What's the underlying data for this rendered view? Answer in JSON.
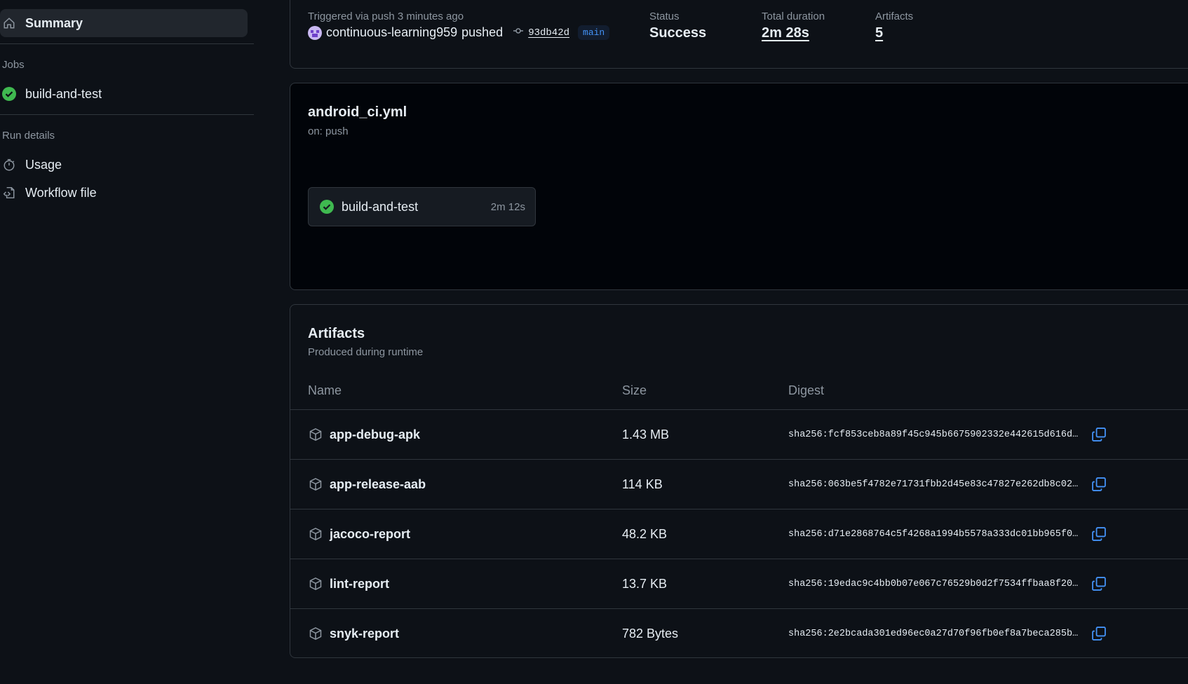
{
  "sidebar": {
    "summary_label": "Summary",
    "jobs_heading": "Jobs",
    "job_label": "build-and-test",
    "run_details_heading": "Run details",
    "usage_label": "Usage",
    "workflow_file_label": "Workflow file"
  },
  "run": {
    "trigger_text": "Triggered via push 3 minutes ago",
    "actor": "continuous-learning959",
    "action": "pushed",
    "commit": "93db42d",
    "branch": "main",
    "status_label": "Status",
    "status_value": "Success",
    "duration_label": "Total duration",
    "duration_value": "2m 28s",
    "artifacts_label": "Artifacts",
    "artifacts_value": "5"
  },
  "workflow": {
    "file": "android_ci.yml",
    "trigger": "on: push",
    "job_name": "build-and-test",
    "job_duration": "2m 12s"
  },
  "artifacts": {
    "title": "Artifacts",
    "subtitle": "Produced during runtime",
    "columns": [
      "Name",
      "Size",
      "Digest"
    ],
    "rows": [
      {
        "name": "app-debug-apk",
        "size": "1.43 MB",
        "digest": "sha256:fcf853ceb8a89f45c945b6675902332e442615d616d…"
      },
      {
        "name": "app-release-aab",
        "size": "114 KB",
        "digest": "sha256:063be5f4782e71731fbb2d45e83c47827e262db8c02…"
      },
      {
        "name": "jacoco-report",
        "size": "48.2 KB",
        "digest": "sha256:d71e2868764c5f4268a1994b5578a333dc01bb965f0…"
      },
      {
        "name": "lint-report",
        "size": "13.7 KB",
        "digest": "sha256:19edac9c4bb0b07e067c76529b0d2f7534ffbaa8f20…"
      },
      {
        "name": "snyk-report",
        "size": "782 Bytes",
        "digest": "sha256:2e2bcada301ed96ec0a27d70f96fb0ef8a7beca285b…"
      }
    ]
  },
  "colors": {
    "success": "#3fb950",
    "link": "#4493f8",
    "background": "#0d1117"
  }
}
